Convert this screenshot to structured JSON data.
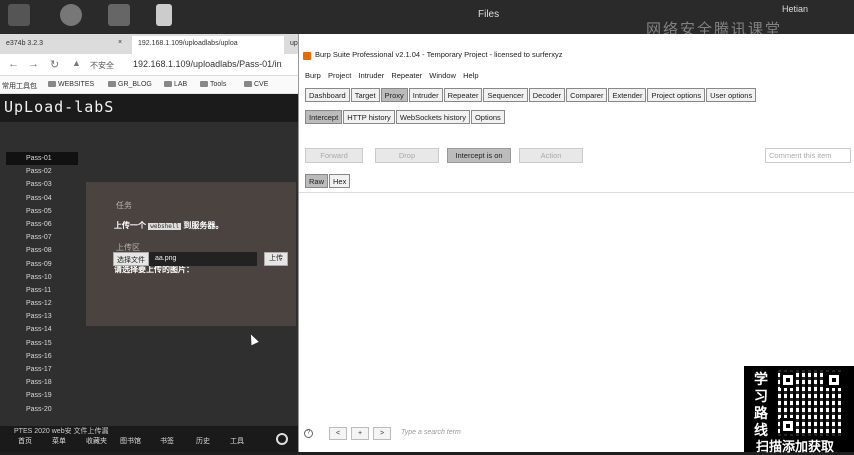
{
  "desktop": {
    "title": "Files",
    "user": "Hetian",
    "watermark": "网络安全腾讯课堂"
  },
  "browser": {
    "tabs": [
      {
        "label": "e374b 3.2.3"
      },
      {
        "label": "192.168.1.109/uploadlabs/uploa"
      },
      {
        "label": "upload-labs"
      }
    ],
    "insecure_label": "不安全",
    "url": "192.168.1.109/uploadlabs/Pass-01/in",
    "bookmarks": [
      "常用工具包",
      "WEBSITES",
      "GR_BLOG",
      "LAB",
      "Tools",
      "CVE"
    ]
  },
  "uploadlabs": {
    "logo": "UpLoad-labS",
    "passes": [
      "Pass-01",
      "Pass-02",
      "Pass-03",
      "Pass-04",
      "Pass-05",
      "Pass-06",
      "Pass-07",
      "Pass-08",
      "Pass-09",
      "Pass-10",
      "Pass-11",
      "Pass-12",
      "Pass-13",
      "Pass-14",
      "Pass-15",
      "Pass-16",
      "Pass-17",
      "Pass-18",
      "Pass-19",
      "Pass-20"
    ],
    "task_heading": "任务",
    "task_text_pre": "上传一个",
    "task_code": "webshell",
    "task_text_post": "到服务器。",
    "upload_heading": "上传区",
    "upload_prompt": "请选择要上传的图片：",
    "choose_file_label": "选择文件",
    "file_name": "aa.png",
    "upload_button": "上传"
  },
  "burp": {
    "title": "Burp Suite Professional v2.1.04 - Temporary Project - licensed to surferxyz",
    "menu": [
      "Burp",
      "Project",
      "Intruder",
      "Repeater",
      "Window",
      "Help"
    ],
    "main_tabs": [
      "Dashboard",
      "Target",
      "Proxy",
      "Intruder",
      "Repeater",
      "Sequencer",
      "Decoder",
      "Comparer",
      "Extender",
      "Project options",
      "User options"
    ],
    "sub_tabs": [
      "Intercept",
      "HTTP history",
      "WebSockets history",
      "Options"
    ],
    "toolbar": {
      "forward": "Forward",
      "drop": "Drop",
      "intercept": "Intercept is on",
      "action": "Action",
      "comment_placeholder": "Comment this item"
    },
    "view_tabs": [
      "Raw",
      "Hex"
    ],
    "search": {
      "help": "?",
      "prev": "<",
      "add": "+",
      "next": ">",
      "placeholder": "Type a search term"
    }
  },
  "taskbar": {
    "status": "PTES     2020 web安    文件上传漏",
    "items": [
      "首页",
      "菜单",
      "收藏夹",
      "图书馆",
      "书签",
      "历史",
      "工具"
    ]
  },
  "ad": {
    "side_text": "学习路线",
    "bottom_text": "扫描添加获取"
  }
}
